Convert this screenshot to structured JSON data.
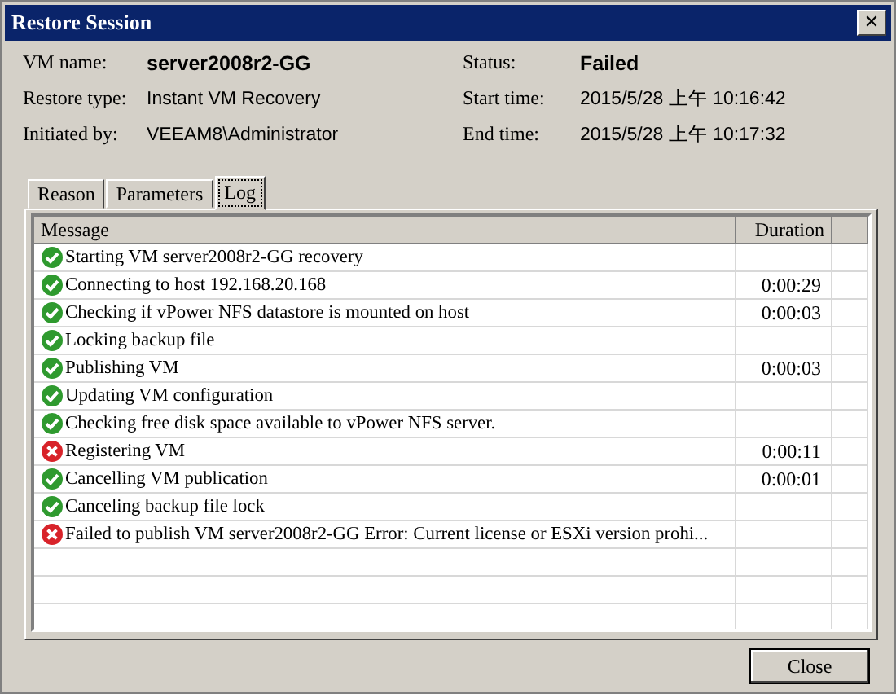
{
  "window": {
    "title": "Restore Session",
    "close_glyph": "✕"
  },
  "details": [
    {
      "label": "VM name:",
      "value": "server2008r2-GG",
      "emphasis": true
    },
    {
      "label": "Status:",
      "value": "Failed",
      "emphasis": true
    },
    {
      "label": "Restore type:",
      "value": "Instant VM Recovery",
      "emphasis": false
    },
    {
      "label": "Start time:",
      "value": "2015/5/28 上午 10:16:42",
      "emphasis": false
    },
    {
      "label": "Initiated by:",
      "value": "VEEAM8\\Administrator",
      "emphasis": false
    },
    {
      "label": "End time:",
      "value": "2015/5/28 上午 10:17:32",
      "emphasis": false
    }
  ],
  "tabs": [
    {
      "label": "Reason",
      "selected": false
    },
    {
      "label": "Parameters",
      "selected": false
    },
    {
      "label": "Log",
      "selected": true
    }
  ],
  "log": {
    "columns": [
      "Message",
      "Duration"
    ],
    "rows": [
      {
        "kind": "ok",
        "message": "Starting VM server2008r2-GG recovery",
        "duration": ""
      },
      {
        "kind": "ok",
        "message": "Connecting to host 192.168.20.168",
        "duration": "0:00:29"
      },
      {
        "kind": "ok",
        "message": "Checking if vPower NFS datastore is mounted on host",
        "duration": "0:00:03"
      },
      {
        "kind": "ok",
        "message": "Locking backup file",
        "duration": ""
      },
      {
        "kind": "ok",
        "message": "Publishing VM",
        "duration": "0:00:03"
      },
      {
        "kind": "ok",
        "message": "Updating VM configuration",
        "duration": ""
      },
      {
        "kind": "ok",
        "message": "Checking free disk space available to vPower NFS server.",
        "duration": ""
      },
      {
        "kind": "error",
        "message": "Registering VM",
        "duration": "0:00:11"
      },
      {
        "kind": "ok",
        "message": "Cancelling VM publication",
        "duration": "0:00:01"
      },
      {
        "kind": "ok",
        "message": "Canceling backup file lock",
        "duration": ""
      },
      {
        "kind": "error",
        "message": "Failed to publish VM server2008r2-GG Error: Current license or ESXi version prohi...",
        "duration": ""
      }
    ]
  },
  "buttons": [
    "Close"
  ]
}
